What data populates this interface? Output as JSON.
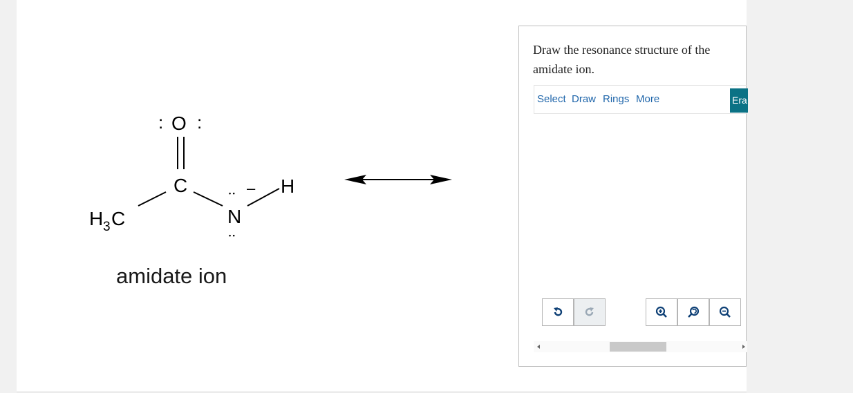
{
  "question": {
    "prompt": "Draw the resonance structure of the amidate ion."
  },
  "molecule": {
    "caption": "amidate ion",
    "atoms": {
      "oxygen": "O",
      "carbon": "C",
      "nitrogen": "N",
      "hydrogen": "H",
      "methyl": "H",
      "methyl_subscript": "3",
      "methyl_tail": "C",
      "charge": "–",
      "lone_pair_left": ":",
      "lone_pair_right": ":",
      "lone_pair_top": "• •",
      "lone_pair_bottom": "• •"
    }
  },
  "toolbar": {
    "select_label": "Select",
    "draw_label": "Draw",
    "rings_label": "Rings",
    "more_label": "More",
    "erase_label": "Era"
  },
  "colors": {
    "menu_link": "#2167ab",
    "erase_button": "#0b7285",
    "icon_blue": "#0d3f75"
  },
  "icons": {
    "undo": "undo-icon",
    "redo": "redo-icon",
    "zoom_in": "zoom-in-icon",
    "zoom_reset": "zoom-reset-icon",
    "zoom_out": "zoom-out-icon",
    "arrow": "resonance-arrow-icon"
  }
}
